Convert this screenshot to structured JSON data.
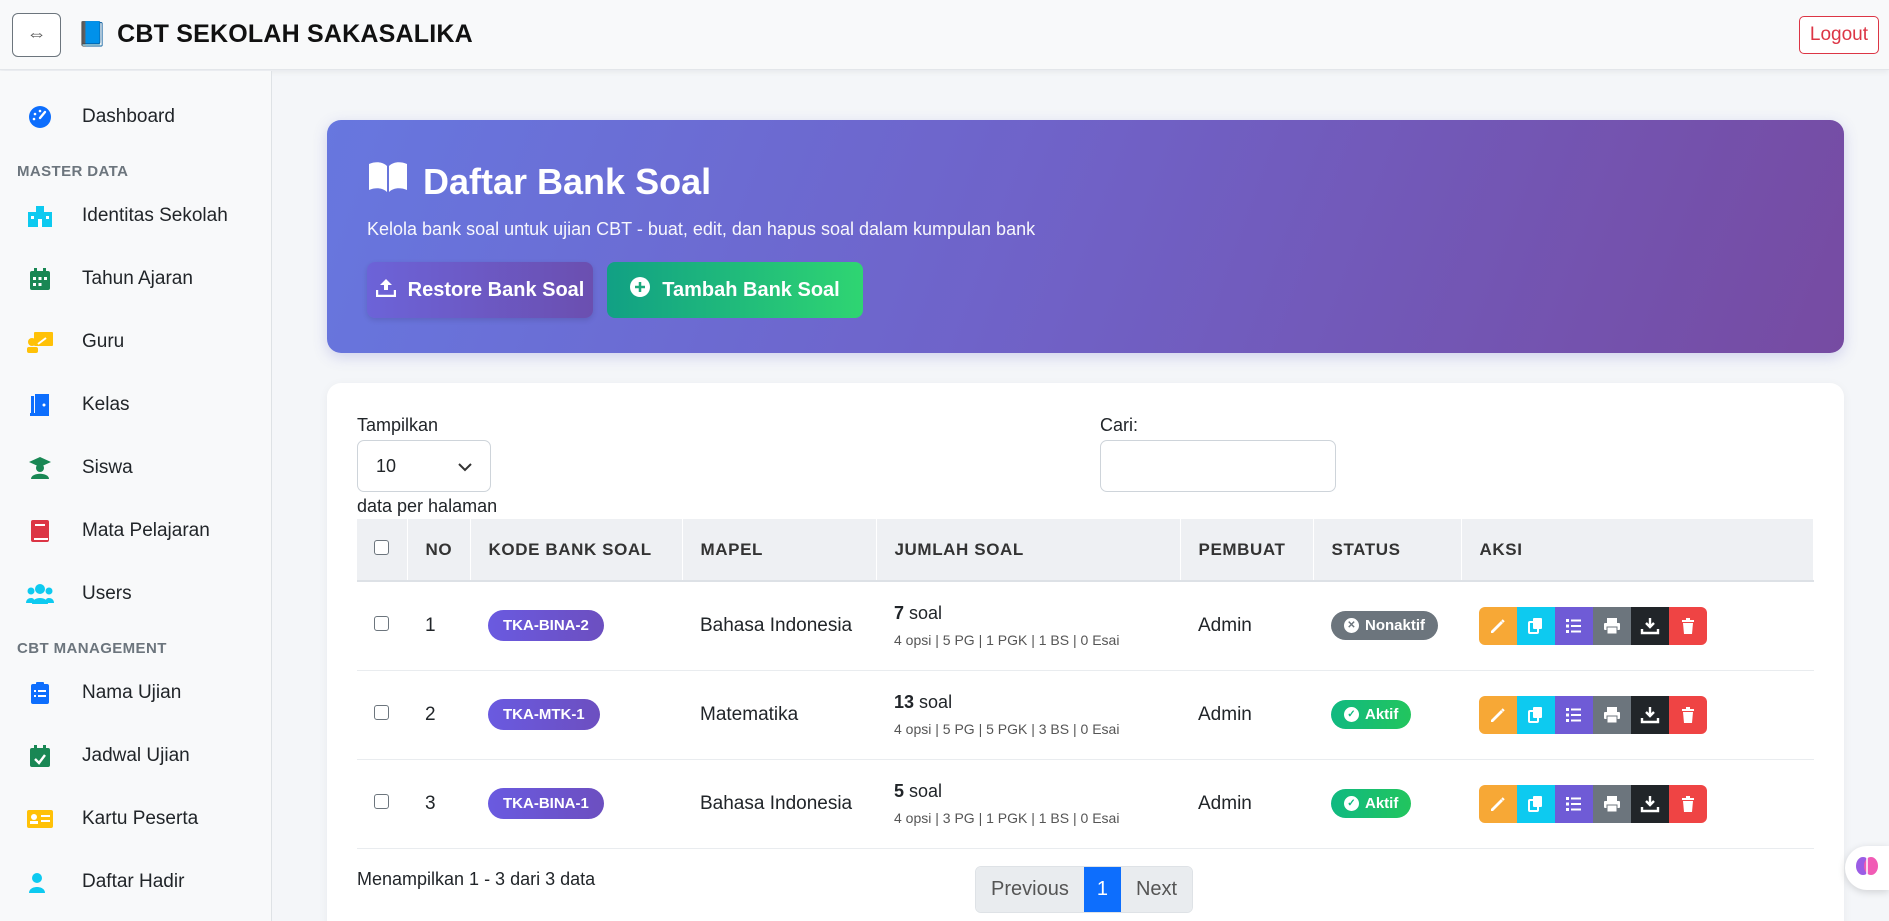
{
  "navbar": {
    "toggle_icon": "⇔",
    "brand_icon": "📘",
    "title": "CBT SEKOLAH SAKASALIKA",
    "logout_label": "Logout"
  },
  "sidebar": {
    "dashboard": "Dashboard",
    "section_master": "MASTER DATA",
    "master_items": [
      "Identitas Sekolah",
      "Tahun Ajaran",
      "Guru",
      "Kelas",
      "Siswa",
      "Mata Pelajaran",
      "Users"
    ],
    "section_cbt": "CBT MANAGEMENT",
    "cbt_items": [
      "Nama Ujian",
      "Jadwal Ujian",
      "Kartu Peserta",
      "Daftar Hadir"
    ]
  },
  "hero": {
    "title": "Daftar Bank Soal",
    "subtitle": "Kelola bank soal untuk ujian CBT - buat, edit, dan hapus soal dalam kumpulan bank",
    "restore_label": "Restore Bank Soal",
    "add_label": "Tambah Bank Soal"
  },
  "controls": {
    "show_label": "Tampilkan",
    "page_size": "10",
    "per_page_label": "data per halaman",
    "search_label": "Cari:",
    "search_value": ""
  },
  "table": {
    "headers": [
      "NO",
      "KODE BANK SOAL",
      "MAPEL",
      "JUMLAH SOAL",
      "PEMBUAT",
      "STATUS",
      "AKSI"
    ],
    "rows": [
      {
        "no": "1",
        "kode": "TKA-BINA-2",
        "mapel": "Bahasa Indonesia",
        "jumlah": "7",
        "soal_word": "soal",
        "detail": "4 opsi | 5 PG | 1 PGK | 1 BS | 0 Esai",
        "pembuat": "Admin",
        "status": "Nonaktif"
      },
      {
        "no": "2",
        "kode": "TKA-MTK-1",
        "mapel": "Matematika",
        "jumlah": "13",
        "soal_word": "soal",
        "detail": "4 opsi | 5 PG | 5 PGK | 3 BS | 0 Esai",
        "pembuat": "Admin",
        "status": "Aktif"
      },
      {
        "no": "3",
        "kode": "TKA-BINA-1",
        "mapel": "Bahasa Indonesia",
        "jumlah": "5",
        "soal_word": "soal",
        "detail": "4 opsi | 3 PG | 1 PGK | 1 BS | 0 Esai",
        "pembuat": "Admin",
        "status": "Aktif"
      }
    ]
  },
  "footer": {
    "info": "Menampilkan 1 - 3 dari 3 data",
    "prev": "Previous",
    "page": "1",
    "next": "Next"
  },
  "colors": {
    "primary": "#0d6efd",
    "danger": "#dc3545",
    "success": "#20c997",
    "status_inactive": "#6c757d"
  }
}
